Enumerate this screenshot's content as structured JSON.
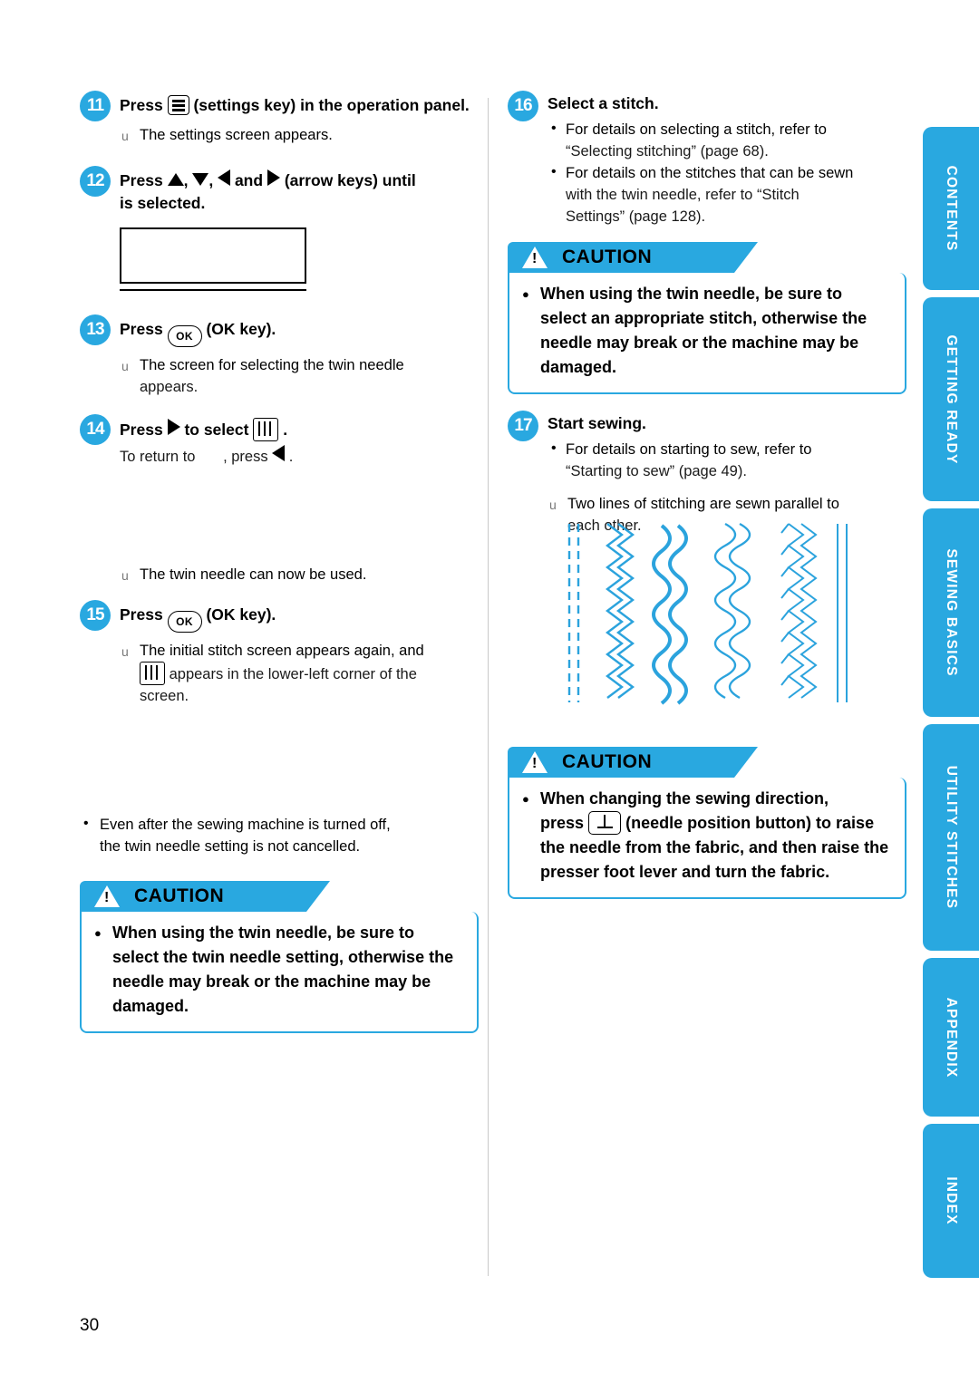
{
  "page": {
    "number": "30"
  },
  "left_column": {
    "step11": {
      "badge": "11",
      "head_before": "Press",
      "head_after": "(settings key) in the operation panel.",
      "result": "The settings screen appears."
    },
    "step12": {
      "badge": "12",
      "head_before": "Press",
      "head_mid1": ",",
      "head_mid2": ",",
      "head_and": "and",
      "head_after": "(arrow keys) until",
      "head_line2": "is selected."
    },
    "step13": {
      "badge": "13",
      "head_before": "Press",
      "key_label": "OK",
      "head_after": "(OK key).",
      "result_line1": "The screen for selecting the twin needle",
      "result_line2": "appears."
    },
    "step14": {
      "badge": "14",
      "head_before": "Press",
      "head_mid": "to select",
      "head_after": ".",
      "sub_before": "To return to",
      "sub_mid": ", press",
      "sub_after": ".",
      "result": "The twin needle can now be used."
    },
    "step15": {
      "badge": "15",
      "head_before": "Press",
      "key_label": "OK",
      "head_after": "(OK key).",
      "result_line1": "The initial stitch screen appears again, and",
      "result_line2_after": "appears in the lower-left corner of the",
      "result_line3": "screen."
    },
    "note": {
      "line1": "Even after the sewing machine is turned off,",
      "line2": "the twin needle setting is not cancelled."
    },
    "caution": {
      "title": "CAUTION",
      "text": "When using the twin needle, be sure to select the twin needle setting, otherwise the needle may break or the machine may be damaged."
    }
  },
  "right_column": {
    "step16": {
      "badge": "16",
      "head": "Select a stitch.",
      "bullet1_line1": "For details on selecting a stitch, refer to",
      "bullet1_line2": "“Selecting stitching” (page 68).",
      "bullet2_line1": "For details on the stitches that can be sewn",
      "bullet2_line2": "with the twin needle, refer to “Stitch",
      "bullet2_line3": "Settings” (page 128)."
    },
    "caution_top": {
      "title": "CAUTION",
      "text": "When using the twin needle, be sure to select an appropriate stitch, otherwise the needle may break or the machine may be damaged."
    },
    "step17": {
      "badge": "17",
      "head": "Start sewing.",
      "bullet_line1": "For details on starting to sew, refer to",
      "bullet_line2": "“Starting to sew” (page 49).",
      "result_line1": "Two lines of stitching are sewn parallel to",
      "result_line2": "each other."
    },
    "caution_bottom": {
      "title": "CAUTION",
      "text_part1": "When changing the sewing direction,",
      "text_part2": "press",
      "text_part3": "(needle position button) to raise the needle from the fabric, and then raise the presser foot lever and turn the fabric."
    }
  },
  "side_tabs": [
    {
      "label": "CONTENTS"
    },
    {
      "label": "GETTING READY"
    },
    {
      "label": "SEWING BASICS"
    },
    {
      "label": "UTILITY STITCHES"
    },
    {
      "label": "APPENDIX"
    },
    {
      "label": "INDEX"
    }
  ],
  "colors": {
    "accent": "#29a8e0",
    "stitch": "#2ba3dd",
    "text": "#000000"
  }
}
